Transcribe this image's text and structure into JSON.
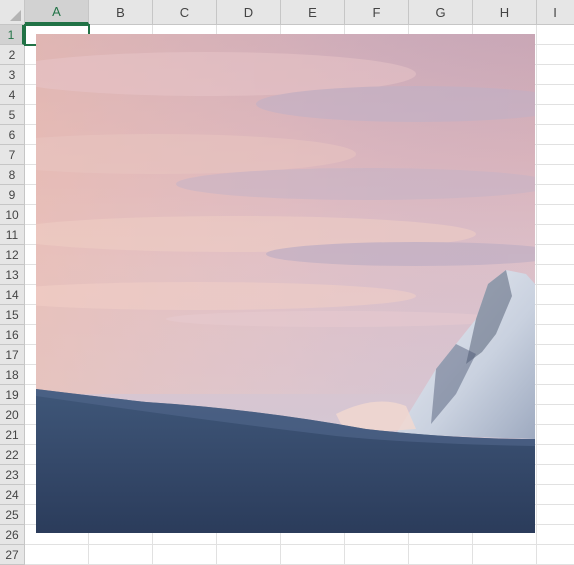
{
  "spreadsheet": {
    "columns": [
      "A",
      "B",
      "C",
      "D",
      "E",
      "F",
      "G",
      "H",
      "I"
    ],
    "rows": [
      "1",
      "2",
      "3",
      "4",
      "5",
      "6",
      "7",
      "8",
      "9",
      "10",
      "11",
      "12",
      "13",
      "14",
      "15",
      "16",
      "17",
      "18",
      "19",
      "20",
      "21",
      "22",
      "23",
      "24",
      "25",
      "26",
      "27"
    ],
    "selected_cell": {
      "column": "A",
      "row": "1"
    }
  },
  "picture": {
    "subject": "mountain-snow-sunset-landscape"
  },
  "colors": {
    "accent": "#217346",
    "header_bg": "#e6e6e6",
    "gridline": "#e1e1e1"
  }
}
